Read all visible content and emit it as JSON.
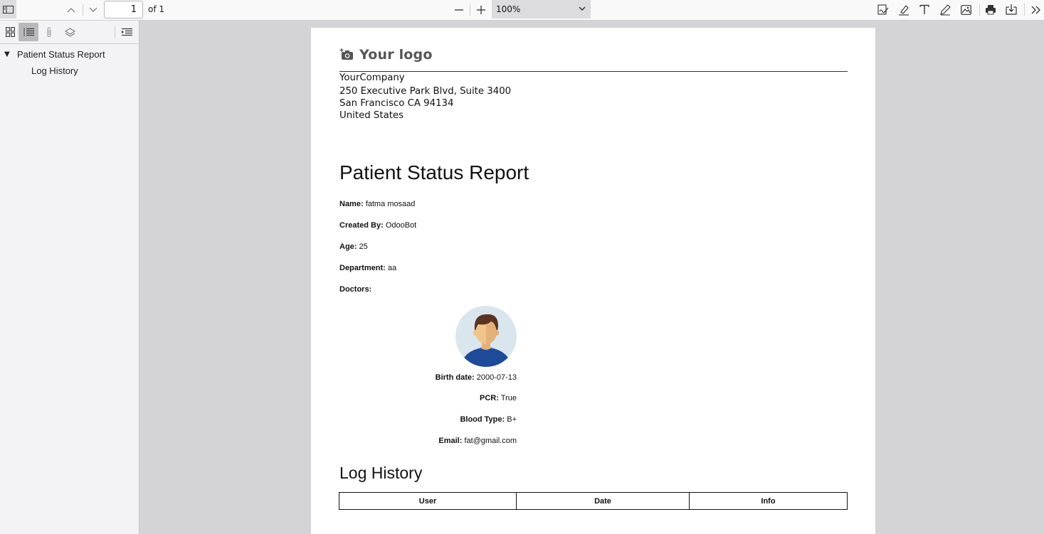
{
  "toolbar": {
    "page_number": "1",
    "page_of": "of 1",
    "zoom_value": "100%"
  },
  "sidebar": {
    "outline": [
      {
        "label": "Patient Status Report"
      },
      {
        "label": "Log History"
      }
    ]
  },
  "document": {
    "logo_text": "Your logo",
    "company": {
      "name": "YourCompany",
      "address1": "250 Executive Park Blvd, Suite 3400",
      "address2": "San Francisco CA 94134",
      "country": "United States"
    },
    "title": "Patient Status Report",
    "fields": {
      "name_label": "Name:",
      "name_value": "fatma mosaad",
      "created_by_label": "Created By:",
      "created_by_value": "OdooBot",
      "age_label": "Age:",
      "age_value": "25",
      "department_label": "Department:",
      "department_value": "aa",
      "doctors_label": "Doctors:"
    },
    "doctor_card": {
      "birth_date_label": "Birth date:",
      "birth_date_value": "2000-07-13",
      "pcr_label": "PCR:",
      "pcr_value": "True",
      "blood_type_label": "Blood Type:",
      "blood_type_value": "B+",
      "email_label": "Email:",
      "email_value": "fat@gmail.com"
    },
    "log_history": {
      "title": "Log History",
      "columns": [
        "User",
        "Date",
        "Info"
      ]
    }
  },
  "colors": {
    "toolbar_bg": "#f9f9fa",
    "viewer_bg": "#d4d4d7",
    "avatar_bg": "#d9e6ee",
    "avatar_shirt": "#1e4a9a"
  }
}
